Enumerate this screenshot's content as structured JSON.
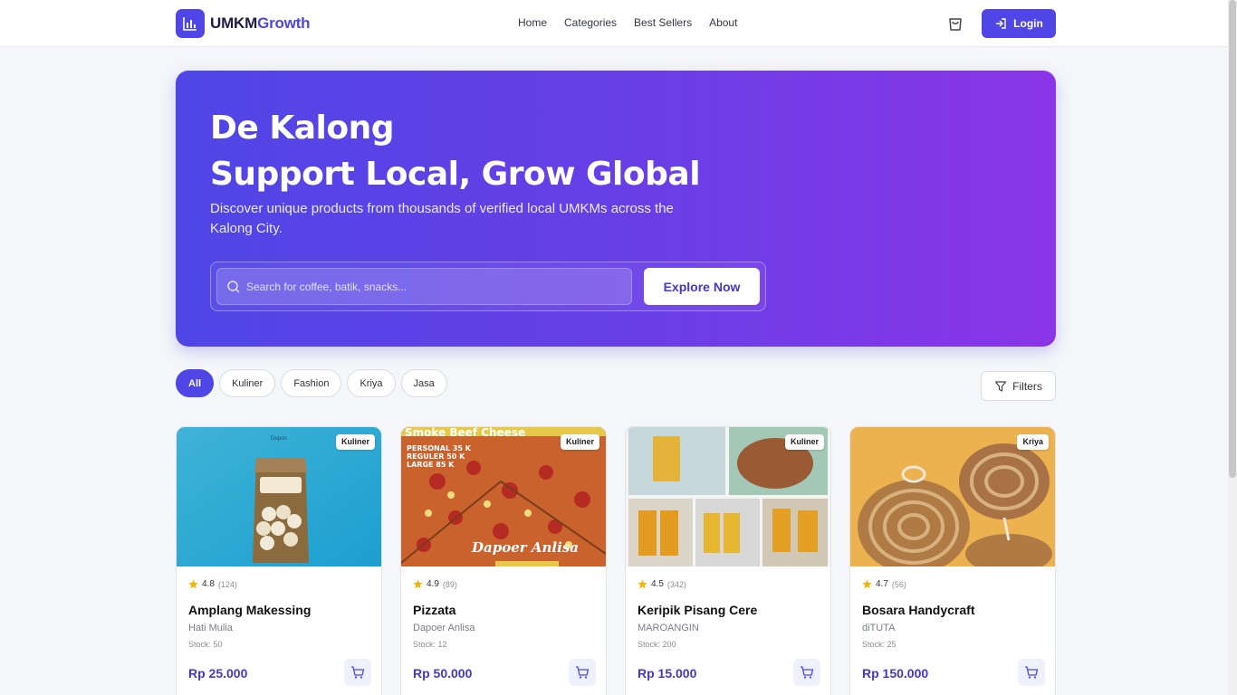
{
  "header": {
    "logo_part1": "UMKM",
    "logo_part2": "Growth",
    "nav": [
      "Home",
      "Categories",
      "Best Sellers",
      "About"
    ],
    "login_label": "Login"
  },
  "hero": {
    "title_line1": "De Kalong",
    "title_line2": "Support Local, Grow Global",
    "subtitle": "Discover unique products from thousands of verified local UMKMs across the Kalong City.",
    "search_placeholder": "Search for coffee, batik, snacks...",
    "explore_label": "Explore Now"
  },
  "chips": [
    "All",
    "Kuliner",
    "Fashion",
    "Kriya",
    "Jasa"
  ],
  "filters_label": "Filters",
  "products": [
    {
      "category": "Kuliner",
      "rating": "4.8",
      "reviews": "(124)",
      "name": "Amplang Makessing",
      "seller": "Hati Mulia",
      "stock": "Stock: 50",
      "price": "Rp 25.000"
    },
    {
      "category": "Kuliner",
      "rating": "4.9",
      "reviews": "(89)",
      "name": "Pizzata",
      "seller": "Dapoer Anlisa",
      "stock": "Stock: 12",
      "price": "Rp 50.000"
    },
    {
      "category": "Kuliner",
      "rating": "4.5",
      "reviews": "(342)",
      "name": "Keripik Pisang Cere",
      "seller": "MAROANGIN",
      "stock": "Stock: 200",
      "price": "Rp 15.000"
    },
    {
      "category": "Kriya",
      "rating": "4.7",
      "reviews": "(56)",
      "name": "Bosara Handycraft",
      "seller": "diTUTA",
      "stock": "Stock: 25",
      "price": "Rp 150.000"
    }
  ],
  "image_text": {
    "p1_brand": "Depon",
    "p2_banner": "Smoke Beef Cheese",
    "p2_menu": [
      "PERSONAL 35 K",
      "REGULER 50 K",
      "LARGE 85 K"
    ],
    "p2_logo": "Dapoer Anlisa"
  },
  "colors": {
    "accent": "#4f46e5",
    "price": "#4338ca",
    "star": "#f5b301"
  }
}
